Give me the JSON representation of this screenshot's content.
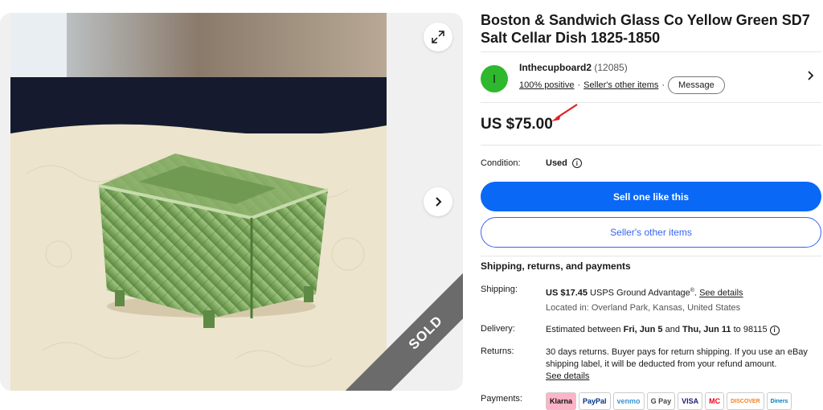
{
  "product": {
    "title": "Boston & Sandwich Glass Co Yellow Green SD7 Salt Cellar Dish 1825-1850",
    "sold_banner": "SOLD"
  },
  "seller": {
    "avatar_initial": "I",
    "name": "Inthecupboard2",
    "feedback_count": "(12085)",
    "positive": "100% positive",
    "other_items": "Seller's other items",
    "message_label": "Message"
  },
  "price": "US $75.00",
  "condition": {
    "label": "Condition:",
    "value": "Used"
  },
  "buttons": {
    "sell_like_this": "Sell one like this",
    "sellers_other_items": "Seller's other items"
  },
  "shipping": {
    "heading": "Shipping, returns, and payments",
    "shipping_label": "Shipping:",
    "shipping_price": "US $17.45",
    "shipping_service": "USPS Ground Advantage",
    "shipping_trademark": "®",
    "see_details": "See details",
    "location": "Located in: Overland Park, Kansas, United States",
    "delivery_label": "Delivery:",
    "delivery_prefix": "Estimated between",
    "delivery_start": "Fri, Jun 5",
    "delivery_and": "and",
    "delivery_end": "Thu, Jun 11",
    "delivery_to": "to 98115",
    "returns_label": "Returns:",
    "returns_text": "30 days returns. Buyer pays for return shipping. If you use an eBay shipping label, it will be deducted from your refund amount.",
    "returns_details": "See details",
    "payments_label": "Payments:",
    "payment_methods": [
      "Klarna",
      "PayPal",
      "venmo",
      "G Pay",
      "VISA",
      "MC",
      "DISCOVER",
      "Diners"
    ]
  },
  "colors": {
    "primary": "#0968f6",
    "secondary_border": "#3665f3",
    "avatar": "#2eb82e",
    "arrow": "#e02020"
  }
}
